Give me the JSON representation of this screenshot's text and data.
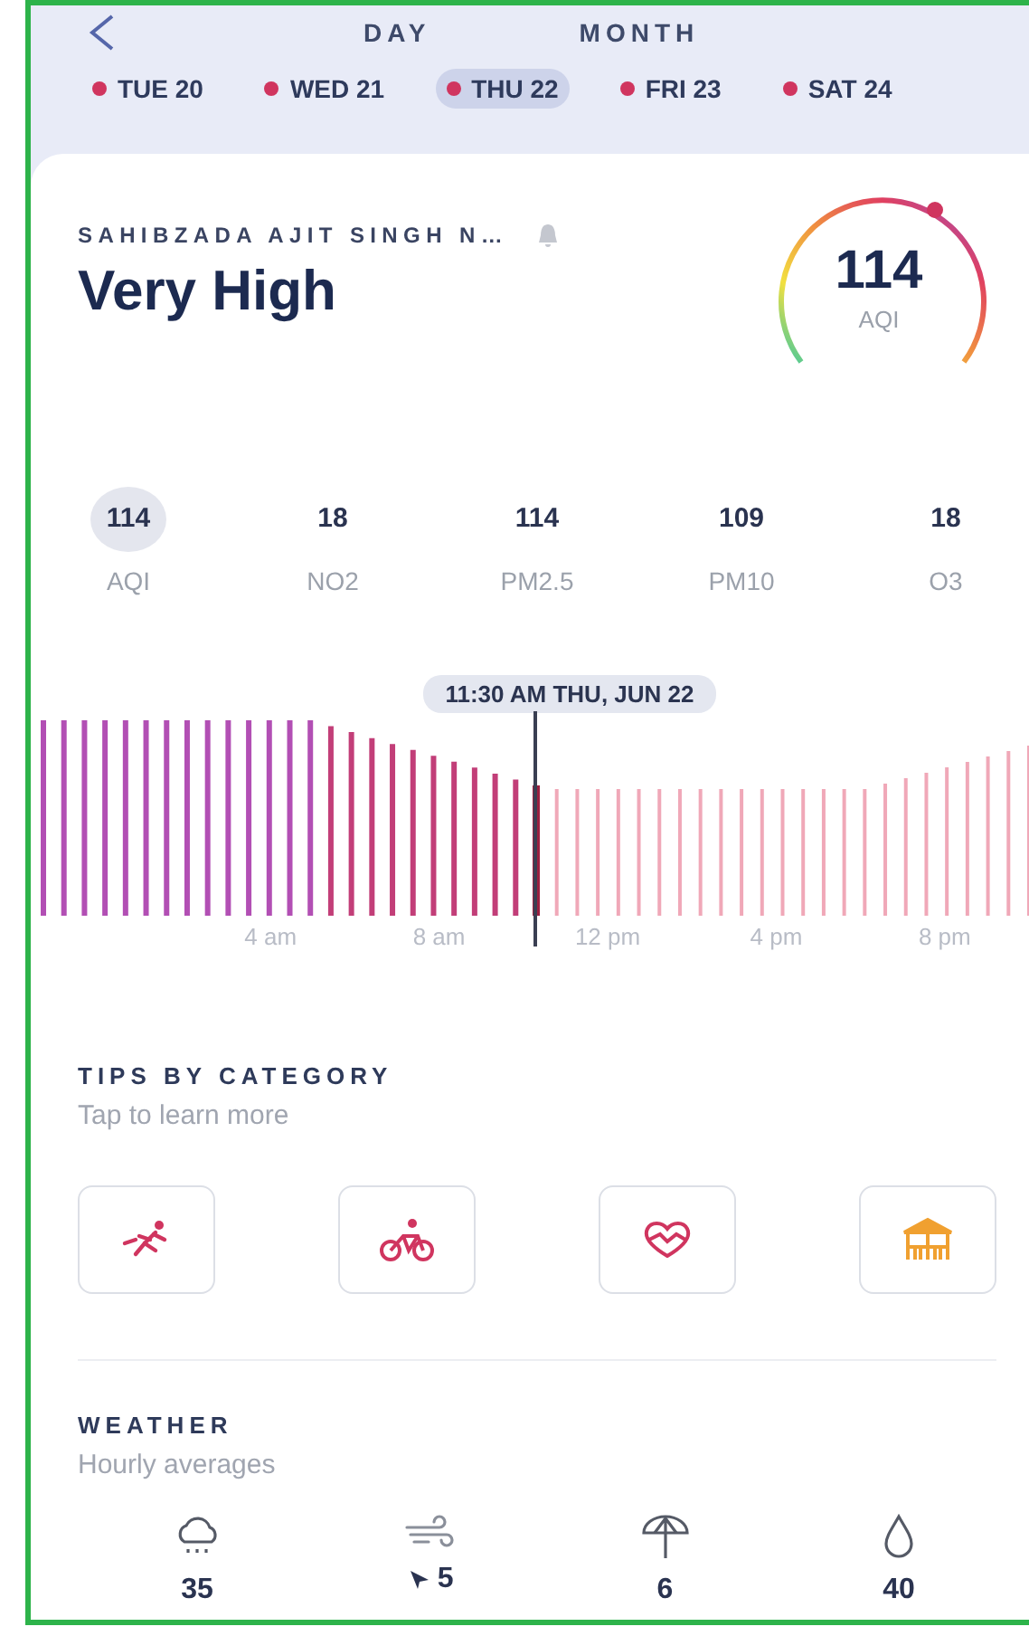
{
  "header": {
    "tabs": [
      {
        "label": "DAY"
      },
      {
        "label": "MONTH"
      }
    ],
    "dates": [
      {
        "label": "TUE 20",
        "selected": false,
        "color": "#d0355f"
      },
      {
        "label": "WED 21",
        "selected": false,
        "color": "#d0355f"
      },
      {
        "label": "THU 22",
        "selected": true,
        "color": "#d0355f"
      },
      {
        "label": "FRI 23",
        "selected": false,
        "color": "#d0355f"
      },
      {
        "label": "SAT 24",
        "selected": false,
        "color": "#d0355f"
      }
    ]
  },
  "summary": {
    "location": "SAHIBZADA AJIT SINGH N…",
    "category": "Very High",
    "aqi": "114",
    "aqi_label": "AQI"
  },
  "pollutants": [
    {
      "value": "114",
      "name": "AQI",
      "selected": true
    },
    {
      "value": "18",
      "name": "NO2",
      "selected": false
    },
    {
      "value": "114",
      "name": "PM2.5",
      "selected": false
    },
    {
      "value": "109",
      "name": "PM10",
      "selected": false
    },
    {
      "value": "18",
      "name": "O3",
      "selected": false
    }
  ],
  "timeline": {
    "cursor_label": "11:30 AM THU, JUN 22",
    "axis_labels": [
      "4 am",
      "8 am",
      "12 pm",
      "4 pm",
      "8 pm"
    ]
  },
  "tips": {
    "title": "TIPS BY CATEGORY",
    "subtitle": "Tap to learn more",
    "categories": [
      {
        "kind": "running"
      },
      {
        "kind": "cycling"
      },
      {
        "kind": "health"
      },
      {
        "kind": "outdoor"
      }
    ]
  },
  "weather": {
    "title": "WEATHER",
    "subtitle": "Hourly averages",
    "items": [
      {
        "kind": "rain",
        "value": "35"
      },
      {
        "kind": "wind",
        "value": "5"
      },
      {
        "kind": "umbrella",
        "value": "6"
      },
      {
        "kind": "humidity",
        "value": "40"
      }
    ]
  }
}
